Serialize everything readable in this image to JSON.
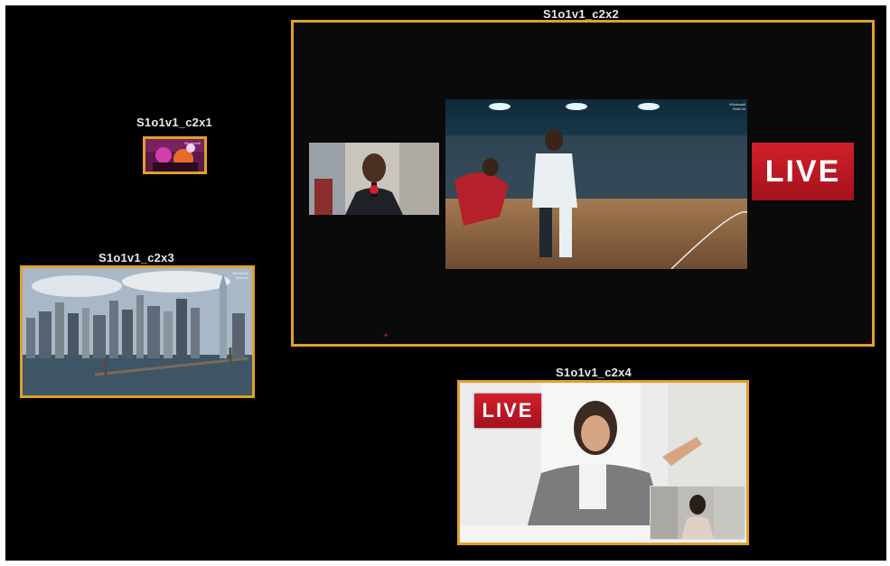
{
  "windows": {
    "c2x1": {
      "title": "S1o1v1_c2x1"
    },
    "c2x2": {
      "title": "S1o1v1_c2x2",
      "badge": "LIVE"
    },
    "c2x3": {
      "title": "S1o1v1_c2x3"
    },
    "c2x4": {
      "title": "S1o1v1_c2x4",
      "badge": "LIVE"
    }
  },
  "watermark": {
    "line1": "Windowsfi",
    "line2": "StatCnd"
  },
  "colors": {
    "window_border": "#e0a02a",
    "background": "#000000",
    "label": "#e8e8e8",
    "live_red": "#c81e28"
  },
  "icons": {
    "crosshair": "+"
  }
}
